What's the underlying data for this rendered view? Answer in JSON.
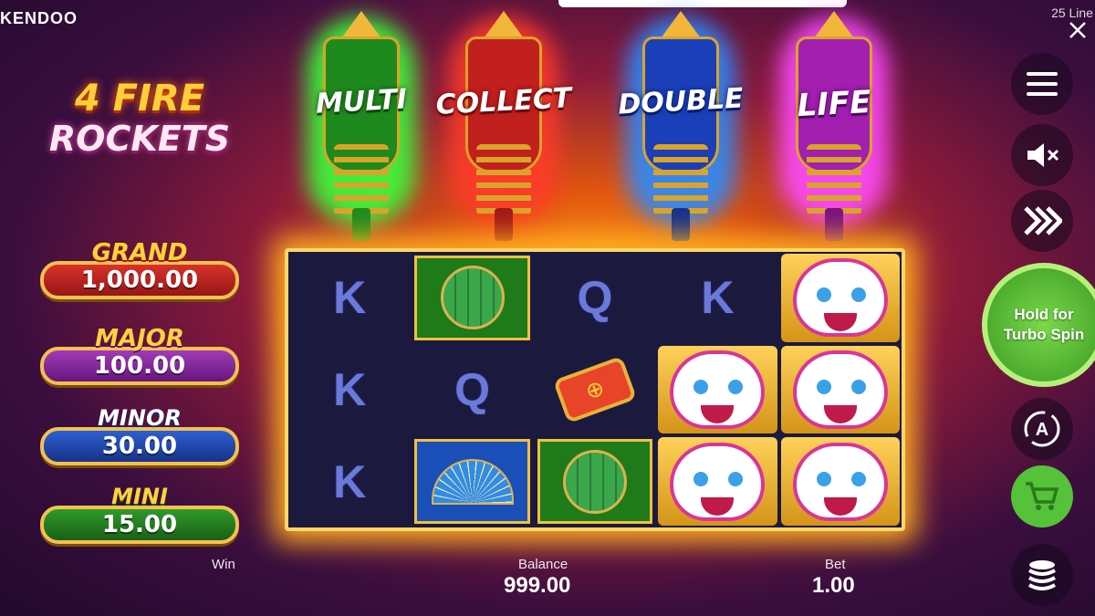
{
  "header": {
    "brand": "KENDOO",
    "lines": "25 Line"
  },
  "logo": {
    "line1": "4 FIRE",
    "line2": "ROCKETS"
  },
  "rockets": [
    {
      "label": "MULTI",
      "color": "#1e8a1e"
    },
    {
      "label": "COLLECT",
      "color": "#c21f1f"
    },
    {
      "label": "DOUBLE",
      "color": "#1a3fb8"
    },
    {
      "label": "LIFE",
      "color": "#a21fb0"
    }
  ],
  "jackpots": {
    "grand": {
      "name": "GRAND",
      "value": "1,000.00"
    },
    "major": {
      "name": "MAJOR",
      "value": "100.00"
    },
    "minor": {
      "name": "MINOR",
      "value": "30.00"
    },
    "mini": {
      "name": "MINI",
      "value": "15.00"
    }
  },
  "reels": {
    "symbols": [
      [
        "K",
        "lantern",
        "Q",
        "K",
        "lion"
      ],
      [
        "K",
        "Q",
        "scroll",
        "lion",
        "lion"
      ],
      [
        "K",
        "fan",
        "lantern",
        "lion",
        "lion"
      ]
    ]
  },
  "controls": {
    "spin_line1": "Hold for",
    "spin_line2": "Turbo Spin",
    "auto_letter": "A"
  },
  "footer": {
    "win_label": "Win",
    "balance_label": "Balance",
    "balance_value": "999.00",
    "bet_label": "Bet",
    "bet_value": "1.00"
  }
}
